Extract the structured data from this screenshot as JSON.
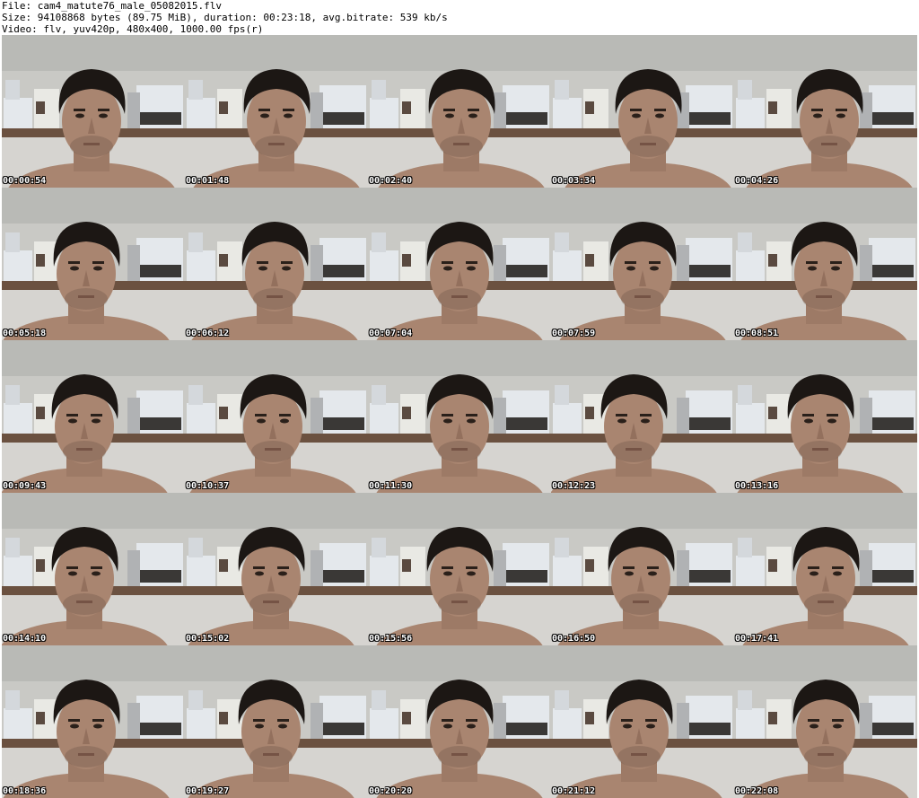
{
  "header": {
    "file_line": "File: cam4_matute76_male_05082015.flv",
    "size_line": "Size: 94108868 bytes (89.75 MiB), duration: 00:23:18, avg.bitrate: 539 kb/s",
    "video_line": "Video: flv, yuv420p, 480x400, 1000.00 fps(r)"
  },
  "colors": {
    "wall": "#c9c9c5",
    "shelf": "#6b5140",
    "skin": "#a98570",
    "hair": "#1c1714",
    "appliance": "#e4e8ec"
  },
  "thumbnails": [
    {
      "timestamp": "00:00:54"
    },
    {
      "timestamp": "00:01:48"
    },
    {
      "timestamp": "00:02:40"
    },
    {
      "timestamp": "00:03:34"
    },
    {
      "timestamp": "00:04:26"
    },
    {
      "timestamp": "00:05:18"
    },
    {
      "timestamp": "00:06:12"
    },
    {
      "timestamp": "00:07:04"
    },
    {
      "timestamp": "00:07:59"
    },
    {
      "timestamp": "00:08:51"
    },
    {
      "timestamp": "00:09:43"
    },
    {
      "timestamp": "00:10:37"
    },
    {
      "timestamp": "00:11:30"
    },
    {
      "timestamp": "00:12:23"
    },
    {
      "timestamp": "00:13:16"
    },
    {
      "timestamp": "00:14:10"
    },
    {
      "timestamp": "00:15:02"
    },
    {
      "timestamp": "00:15:56"
    },
    {
      "timestamp": "00:16:50"
    },
    {
      "timestamp": "00:17:41"
    },
    {
      "timestamp": "00:18:36"
    },
    {
      "timestamp": "00:19:27"
    },
    {
      "timestamp": "00:20:20"
    },
    {
      "timestamp": "00:21:12"
    },
    {
      "timestamp": "00:22:08"
    }
  ]
}
